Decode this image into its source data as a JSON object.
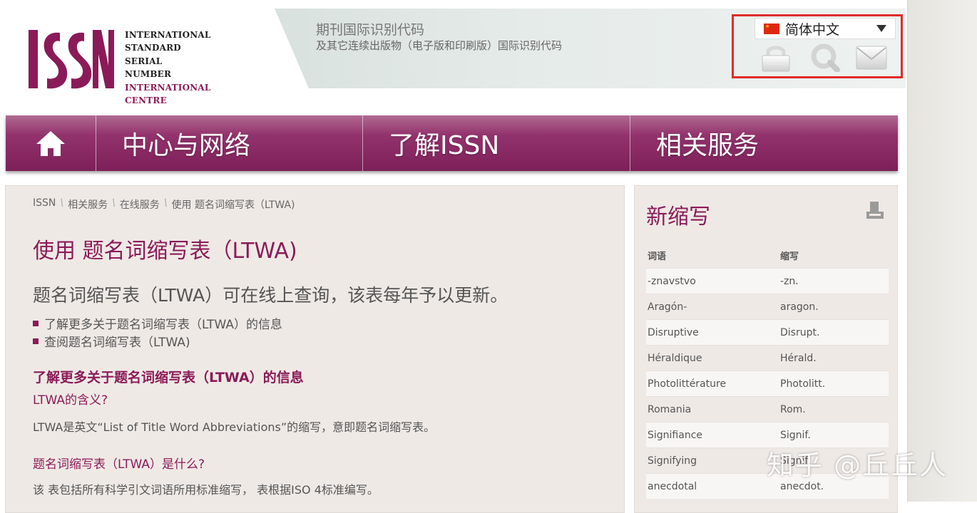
{
  "logo": {
    "lines": [
      "INTERNATIONAL",
      "STANDARD",
      "SERIAL",
      "NUMBER"
    ],
    "centre": "INTERNATIONAL CENTRE",
    "accent": "#8a1b58"
  },
  "header": {
    "tagline_title": "期刊国际识别代码",
    "tagline_sub": "及其它连续出版物（电子版和印刷版）国际识别代码"
  },
  "tools": {
    "language": "简体中文",
    "icons": [
      "lock-icon",
      "search-icon",
      "mail-icon"
    ],
    "highlight_color": "#e02b2b"
  },
  "nav": {
    "home_icon": "home-icon",
    "items": [
      "中心与网络",
      "了解ISSN",
      "相关服务"
    ]
  },
  "breadcrumb": [
    "ISSN",
    "相关服务",
    "在线服务",
    "使用 题名词缩写表（LTWA)"
  ],
  "main": {
    "title": "使用 题名词缩写表（LTWA)",
    "lead": "题名词缩写表（LTWA）可在线上查询，该表每年予以更新。",
    "bullets": [
      "了解更多关于题名词缩写表（LTWA）的信息",
      "查阅题名词缩写表（LTWA)"
    ],
    "section_heading": "了解更多关于题名词缩写表（LTWA）的信息",
    "q1": "LTWA的含义?",
    "a1": "LTWA是英文“List of Title Word Abbreviations”的缩写，意即题名词缩写表。",
    "q2": "题名词缩写表（LTWA）是什么?",
    "a2": "该 表包括所有科学引文词语所用标准缩写， 表根据ISO 4标准编写。"
  },
  "sidebar": {
    "title": "新缩写",
    "col_word": "词语",
    "col_abbr": "缩写",
    "rows": [
      {
        "word": "-znavstvo",
        "abbr": "-zn."
      },
      {
        "word": "Aragón-",
        "abbr": "aragon."
      },
      {
        "word": "Disruptive",
        "abbr": "Disrupt."
      },
      {
        "word": "Héraldique",
        "abbr": "Hérald."
      },
      {
        "word": "Photolittérature",
        "abbr": "Photolitt."
      },
      {
        "word": "Romania",
        "abbr": "Rom."
      },
      {
        "word": "Signifiance",
        "abbr": "Signif."
      },
      {
        "word": "Signifying",
        "abbr": "Signif."
      },
      {
        "word": "anecdotal",
        "abbr": "anecdot."
      }
    ]
  },
  "watermark": "知乎 @丘丘人"
}
